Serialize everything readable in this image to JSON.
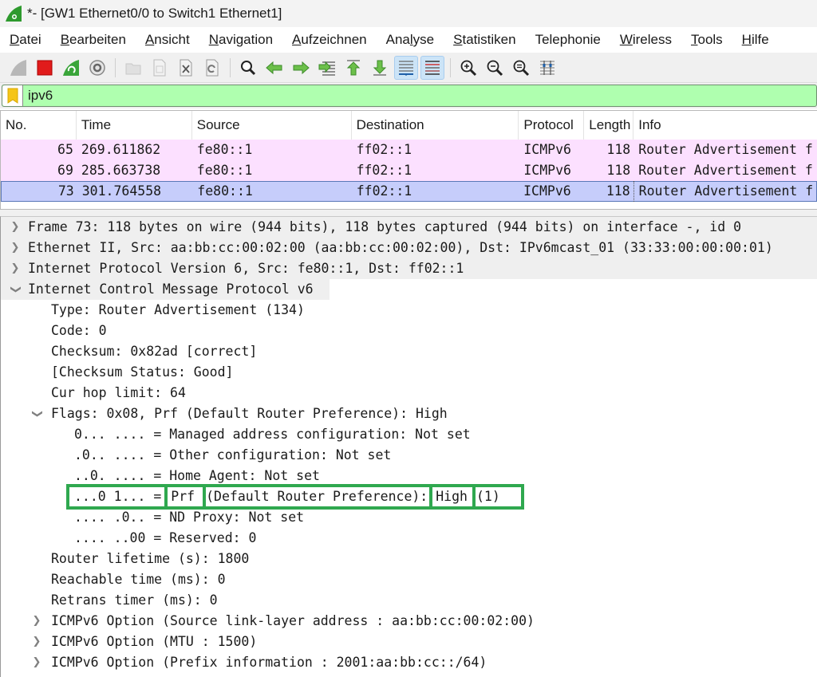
{
  "window": {
    "title": "*- [GW1 Ethernet0/0 to Switch1 Ethernet1]",
    "app_icon": "wireshark-fin-icon"
  },
  "menubar": [
    {
      "label": "Datei",
      "mnemonic": "D",
      "rest": "atei"
    },
    {
      "label": "Bearbeiten",
      "mnemonic": "B",
      "rest": "earbeiten"
    },
    {
      "label": "Ansicht",
      "mnemonic": "A",
      "rest": "nsicht"
    },
    {
      "label": "Navigation",
      "mnemonic": "N",
      "rest": "avigation"
    },
    {
      "label": "Aufzeichnen",
      "mnemonic": "A",
      "rest": "ufzeichnen"
    },
    {
      "label": "Analyse",
      "pre": "Ana",
      "mnemonic": "l",
      "rest": "yse"
    },
    {
      "label": "Statistiken",
      "mnemonic": "S",
      "rest": "tatistiken"
    },
    {
      "label": "Telephonie",
      "mnemonic": "",
      "rest": "Telephonie"
    },
    {
      "label": "Wireless",
      "mnemonic": "W",
      "rest": "ireless"
    },
    {
      "label": "Tools",
      "mnemonic": "T",
      "rest": "ools"
    },
    {
      "label": "Hilfe",
      "mnemonic": "H",
      "rest": "ilfe"
    }
  ],
  "toolbar": {
    "buttons": [
      {
        "icon": "start-capture-icon",
        "enabled": false
      },
      {
        "icon": "stop-capture-icon",
        "enabled": true
      },
      {
        "icon": "restart-capture-icon",
        "enabled": true
      },
      {
        "icon": "capture-options-icon",
        "enabled": true
      },
      {
        "icon": "open-file-icon",
        "enabled": false
      },
      {
        "icon": "save-file-icon",
        "enabled": false
      },
      {
        "icon": "close-file-icon",
        "enabled": true
      },
      {
        "icon": "reload-file-icon",
        "enabled": true
      },
      {
        "icon": "find-packet-icon",
        "enabled": true
      },
      {
        "icon": "go-back-icon",
        "enabled": true
      },
      {
        "icon": "go-forward-icon",
        "enabled": true
      },
      {
        "icon": "go-to-packet-icon",
        "enabled": true
      },
      {
        "icon": "first-packet-icon",
        "enabled": true
      },
      {
        "icon": "last-packet-icon",
        "enabled": true
      },
      {
        "icon": "autoscroll-icon",
        "enabled": true,
        "active": true
      },
      {
        "icon": "colorize-icon",
        "enabled": true,
        "active": true
      },
      {
        "icon": "zoom-in-icon",
        "enabled": true
      },
      {
        "icon": "zoom-out-icon",
        "enabled": true
      },
      {
        "icon": "zoom-reset-icon",
        "enabled": true
      },
      {
        "icon": "resize-columns-icon",
        "enabled": true
      }
    ]
  },
  "filter": {
    "value": "ipv6",
    "status_color": "#afffaf",
    "bookmark_icon": "bookmark-icon"
  },
  "packet_list": {
    "columns": [
      "No.",
      "Time",
      "Source",
      "Destination",
      "Protocol",
      "Length",
      "Info"
    ],
    "rows": [
      {
        "no": "65",
        "time": "269.611862",
        "source": "fe80::1",
        "destination": "ff02::1",
        "protocol": "ICMPv6",
        "length": "118",
        "info": "Router Advertisement f",
        "selected": false
      },
      {
        "no": "69",
        "time": "285.663738",
        "source": "fe80::1",
        "destination": "ff02::1",
        "protocol": "ICMPv6",
        "length": "118",
        "info": "Router Advertisement f",
        "selected": false
      },
      {
        "no": "73",
        "time": "301.764558",
        "source": "fe80::1",
        "destination": "ff02::1",
        "protocol": "ICMPv6",
        "length": "118",
        "info": "Router Advertisement f",
        "selected": true
      }
    ],
    "row_color_icmp": "#fce0ff",
    "row_color_selected": "#c6cdfb"
  },
  "details": {
    "frame": "Frame 73: 118 bytes on wire (944 bits), 118 bytes captured (944 bits) on interface -, id 0",
    "ethernet": "Ethernet II, Src: aa:bb:cc:00:02:00 (aa:bb:cc:00:02:00), Dst: IPv6mcast_01 (33:33:00:00:00:01)",
    "ipv6": "Internet Protocol Version 6, Src: fe80::1, Dst: ff02::1",
    "icmpv6": "Internet Control Message Protocol v6",
    "icmp_fields": {
      "type": "Type: Router Advertisement (134)",
      "code": "Code: 0",
      "checksum": "Checksum: 0x82ad [correct]",
      "checksum_status": "[Checksum Status: Good]",
      "cur_hop_limit": "Cur hop limit: 64",
      "flags": "Flags: 0x08, Prf (Default Router Preference): High",
      "flag_bits": {
        "managed": "0... .... = Managed address configuration: Not set",
        "other": ".0.. .... = Other configuration: Not set",
        "home_agent": "..0. .... = Home Agent: Not set",
        "prf_bits": "...0 1... =",
        "prf_name": "Prf",
        "prf_desc": "(Default Router Preference):",
        "prf_value": "High",
        "prf_code": "(1)",
        "nd_proxy": ".... .0.. = ND Proxy: Not set",
        "reserved": ".... ..00 = Reserved: 0"
      },
      "router_lifetime": "Router lifetime (s): 1800",
      "reachable_time": "Reachable time (ms): 0",
      "retrans_timer": "Retrans timer (ms): 0",
      "opt_sll": "ICMPv6 Option (Source link-layer address : aa:bb:cc:00:02:00)",
      "opt_mtu": "ICMPv6 Option (MTU : 1500)",
      "opt_prefix": "ICMPv6 Option (Prefix information : 2001:aa:bb:cc::/64)"
    },
    "highlight_color": "#2fa84f"
  }
}
